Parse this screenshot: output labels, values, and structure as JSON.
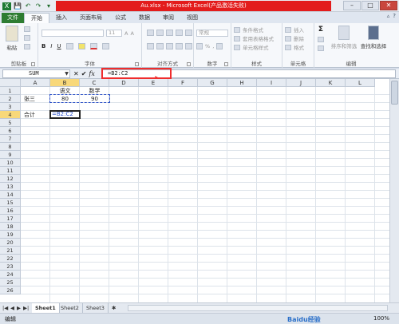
{
  "qat": {
    "save": "💾",
    "undo": "↶",
    "redo": "↷",
    "more": "▾"
  },
  "title": "Au.xlsx - Microsoft Excel(产品激活失败)",
  "window": {
    "minimize": "–",
    "maximize": "□",
    "close": "✕"
  },
  "tabs": [
    {
      "label": "文件"
    },
    {
      "label": "开始"
    },
    {
      "label": "插入"
    },
    {
      "label": "页面布局"
    },
    {
      "label": "公式"
    },
    {
      "label": "数据"
    },
    {
      "label": "审阅"
    },
    {
      "label": "视图"
    }
  ],
  "tab_right": {
    "help": "?",
    "min": "▵"
  },
  "ribbon": {
    "clipboard": {
      "label": "剪贴板",
      "paste": "粘贴"
    },
    "font": {
      "label": "字体",
      "size": "11",
      "bold": "B",
      "italic": "I",
      "underline": "U"
    },
    "alignment": {
      "label": "对齐方式"
    },
    "number": {
      "label": "数字",
      "format": "常规",
      "percent": "%",
      "comma": ","
    },
    "styles": {
      "label": "样式",
      "cond": "条件格式",
      "table": "套用表格格式",
      "cell": "单元格样式"
    },
    "cells": {
      "label": "单元格",
      "insert": "插入",
      "delete": "删除",
      "format": "格式"
    },
    "editing": {
      "label": "编辑",
      "sum": "Σ",
      "sort": "排序和筛选",
      "find": "查找和选择"
    }
  },
  "formula_bar": {
    "name_box": "SUM",
    "formula": "=B2:C2",
    "cancel": "✕",
    "enter": "✔",
    "fx": "fx"
  },
  "columns": [
    "A",
    "B",
    "C",
    "D",
    "E",
    "F",
    "G",
    "H",
    "I",
    "J",
    "K",
    "L"
  ],
  "rows": [
    "1",
    "2",
    "3",
    "4",
    "5",
    "6",
    "7",
    "8",
    "9",
    "10",
    "11",
    "12",
    "13",
    "14",
    "15",
    "16",
    "17",
    "18",
    "19",
    "20",
    "21",
    "22",
    "23",
    "24",
    "25",
    "26"
  ],
  "cells": {
    "b1": "语文",
    "c1": "数学",
    "a2": "张三",
    "b2": "80",
    "c2": "90",
    "a4": "合计",
    "b4": "=B2:C2"
  },
  "sheets": [
    "Sheet1",
    "Sheet2",
    "Sheet3"
  ],
  "sheet_nav": [
    "|◀",
    "◀",
    "▶",
    "▶|"
  ],
  "status": {
    "mode": "编辑",
    "zoom": "100%"
  },
  "watermark": "Baidu经验"
}
